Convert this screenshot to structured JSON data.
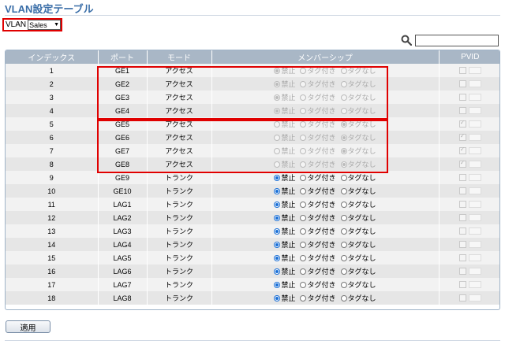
{
  "page_title": "VLAN設定テーブル",
  "vlan": {
    "label": "VLAN",
    "selected": "Sales"
  },
  "search": {
    "value": ""
  },
  "table": {
    "headers": [
      "インデックス",
      "ポート",
      "モード",
      "メンバーシップ",
      "PVID"
    ],
    "membership_options": [
      "禁止",
      "タグ付き",
      "タグなし"
    ],
    "rows": [
      {
        "index": "1",
        "port": "GE1",
        "mode": "アクセス",
        "membership": "禁止",
        "disabled": true,
        "pvid": false
      },
      {
        "index": "2",
        "port": "GE2",
        "mode": "アクセス",
        "membership": "禁止",
        "disabled": true,
        "pvid": false
      },
      {
        "index": "3",
        "port": "GE3",
        "mode": "アクセス",
        "membership": "禁止",
        "disabled": true,
        "pvid": false
      },
      {
        "index": "4",
        "port": "GE4",
        "mode": "アクセス",
        "membership": "禁止",
        "disabled": true,
        "pvid": false
      },
      {
        "index": "5",
        "port": "GE5",
        "mode": "アクセス",
        "membership": "タグなし",
        "disabled": true,
        "pvid": true
      },
      {
        "index": "6",
        "port": "GE6",
        "mode": "アクセス",
        "membership": "タグなし",
        "disabled": true,
        "pvid": true
      },
      {
        "index": "7",
        "port": "GE7",
        "mode": "アクセス",
        "membership": "タグなし",
        "disabled": true,
        "pvid": true
      },
      {
        "index": "8",
        "port": "GE8",
        "mode": "アクセス",
        "membership": "タグなし",
        "disabled": true,
        "pvid": true
      },
      {
        "index": "9",
        "port": "GE9",
        "mode": "トランク",
        "membership": "禁止",
        "disabled": false,
        "pvid": false
      },
      {
        "index": "10",
        "port": "GE10",
        "mode": "トランク",
        "membership": "禁止",
        "disabled": false,
        "pvid": false
      },
      {
        "index": "11",
        "port": "LAG1",
        "mode": "トランク",
        "membership": "禁止",
        "disabled": false,
        "pvid": false
      },
      {
        "index": "12",
        "port": "LAG2",
        "mode": "トランク",
        "membership": "禁止",
        "disabled": false,
        "pvid": false
      },
      {
        "index": "13",
        "port": "LAG3",
        "mode": "トランク",
        "membership": "禁止",
        "disabled": false,
        "pvid": false
      },
      {
        "index": "14",
        "port": "LAG4",
        "mode": "トランク",
        "membership": "禁止",
        "disabled": false,
        "pvid": false
      },
      {
        "index": "15",
        "port": "LAG5",
        "mode": "トランク",
        "membership": "禁止",
        "disabled": false,
        "pvid": false
      },
      {
        "index": "16",
        "port": "LAG6",
        "mode": "トランク",
        "membership": "禁止",
        "disabled": false,
        "pvid": false
      },
      {
        "index": "17",
        "port": "LAG7",
        "mode": "トランク",
        "membership": "禁止",
        "disabled": false,
        "pvid": false
      },
      {
        "index": "18",
        "port": "LAG8",
        "mode": "トランク",
        "membership": "禁止",
        "disabled": false,
        "pvid": false
      }
    ]
  },
  "apply_label": "適用",
  "colors": {
    "title": "#3a6ea8",
    "header_bg": "#a9b7c6",
    "highlight": "#e00000",
    "radio_checked": "#1a6fd6"
  }
}
